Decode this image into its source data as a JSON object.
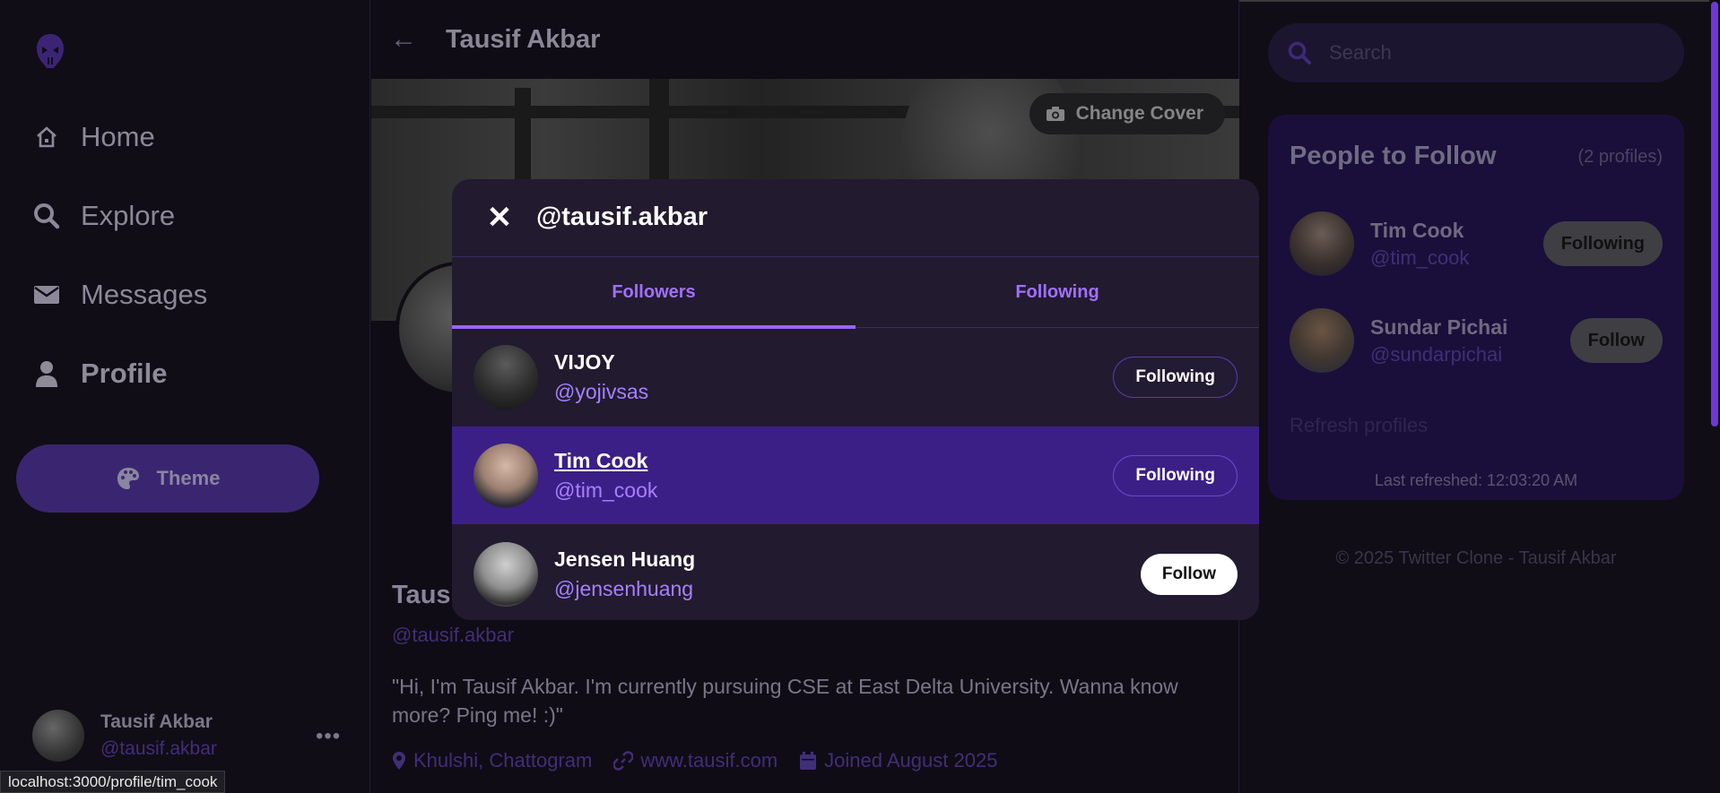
{
  "sidebar": {
    "nav": [
      {
        "label": "Home",
        "icon": "home-icon"
      },
      {
        "label": "Explore",
        "icon": "search-icon"
      },
      {
        "label": "Messages",
        "icon": "envelope-icon"
      },
      {
        "label": "Profile",
        "icon": "user-icon"
      }
    ],
    "theme_label": "Theme",
    "user": {
      "name": "Tausif Akbar",
      "handle": "@tausif.akbar"
    }
  },
  "center": {
    "title": "Tausif Akbar",
    "change_cover_label": "Change Cover",
    "profile": {
      "name": "Tausif Akbar",
      "handle": "@tausif.akbar",
      "bio": "\"Hi, I'm Tausif Akbar. I'm currently pursuing CSE at East Delta University. Wanna know more? Ping me! :)\"",
      "location": "Khulshi, Chattogram",
      "website": "www.tausif.com",
      "joined": "Joined August 2025"
    }
  },
  "right": {
    "search_placeholder": "Search",
    "people_title": "People to Follow",
    "people_count": "(2 profiles)",
    "people": [
      {
        "name": "Tim Cook",
        "handle": "@tim_cook",
        "button": "Following"
      },
      {
        "name": "Sundar Pichai",
        "handle": "@sundarpichai",
        "button": "Follow"
      }
    ],
    "refresh_label": "Refresh profiles",
    "last_refreshed": "Last refreshed: 12:03:20 AM",
    "footer": "© 2025 Twitter Clone - Tausif Akbar"
  },
  "modal": {
    "close": "✕",
    "title": "@tausif.akbar",
    "tabs": [
      {
        "label": "Followers",
        "active": true
      },
      {
        "label": "Following",
        "active": false
      }
    ],
    "users": [
      {
        "name": "VIJOY",
        "handle": "@yojivsas",
        "button": "Following"
      },
      {
        "name": "Tim Cook",
        "handle": "@tim_cook",
        "button": "Following"
      },
      {
        "name": "Jensen Huang",
        "handle": "@jensenhuang",
        "button": "Follow"
      }
    ]
  },
  "status_bar": {
    "url": "localhost:3000/profile/tim_cook"
  },
  "colors": {
    "accent": "#9a63ff",
    "modal_bg": "#221a2f",
    "row_hover": "#3c1f86",
    "handle": "#a481ff"
  }
}
